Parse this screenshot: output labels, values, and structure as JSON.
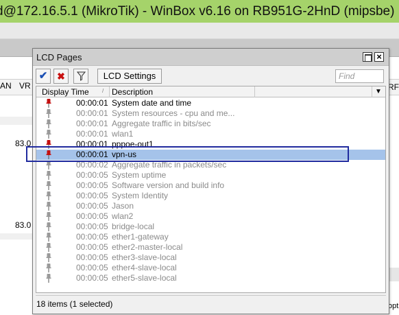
{
  "main_window": {
    "title": "d@172.16.5.1 (MikroTik) - WinBox v6.16 on RB951G-2HnD (mipsbe)",
    "bg_columns": {
      "an": "AN",
      "vr": "VR",
      "rf": "RF"
    },
    "bg_values": [
      "83.0",
      "83.0"
    ],
    "bg_bottom_right": "opt"
  },
  "lcd_window": {
    "title": "LCD Pages",
    "toolbar": {
      "enable_icon": "check-icon",
      "disable_icon": "x-icon",
      "filter_icon": "filter-icon",
      "settings_label": "LCD Settings",
      "find_placeholder": "Find"
    },
    "columns": {
      "display_time": "Display Time",
      "description": "Description"
    },
    "rows": [
      {
        "time": "00:00:01",
        "description": "System date and time",
        "active": true
      },
      {
        "time": "00:00:01",
        "description": "System resources - cpu and me...",
        "active": false
      },
      {
        "time": "00:00:01",
        "description": "Aggregate traffic in bits/sec",
        "active": false
      },
      {
        "time": "00:00:01",
        "description": "wlan1",
        "active": false
      },
      {
        "time": "00:00:01",
        "description": "pppoe-out1",
        "active": true
      },
      {
        "time": "00:00:01",
        "description": "vpn-us",
        "active": true,
        "selected": true
      },
      {
        "time": "00:00:02",
        "description": "Aggregate traffic in packets/sec",
        "active": false
      },
      {
        "time": "00:00:05",
        "description": "System uptime",
        "active": false
      },
      {
        "time": "00:00:05",
        "description": "Software version and build info",
        "active": false
      },
      {
        "time": "00:00:05",
        "description": "System Identity",
        "active": false
      },
      {
        "time": "00:00:05",
        "description": "Jason",
        "active": false
      },
      {
        "time": "00:00:05",
        "description": "wlan2",
        "active": false
      },
      {
        "time": "00:00:05",
        "description": "bridge-local",
        "active": false
      },
      {
        "time": "00:00:05",
        "description": "ether1-gateway",
        "active": false
      },
      {
        "time": "00:00:05",
        "description": "ether2-master-local",
        "active": false
      },
      {
        "time": "00:00:05",
        "description": "ether3-slave-local",
        "active": false
      },
      {
        "time": "00:00:05",
        "description": "ether4-slave-local",
        "active": false
      },
      {
        "time": "00:00:05",
        "description": "ether5-slave-local",
        "active": false
      }
    ],
    "status": "18 items (1 selected)",
    "colors": {
      "pin_active": "#c41010",
      "pin_inactive": "#9a9a9a",
      "selection": "#a5c3ea",
      "title_bar": "#a5d36a"
    }
  }
}
